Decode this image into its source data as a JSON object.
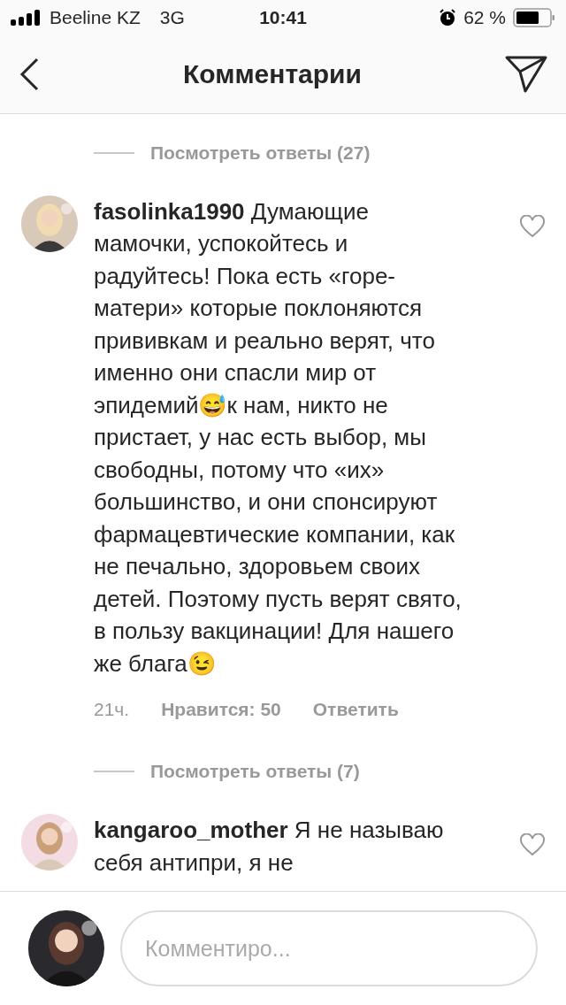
{
  "status_bar": {
    "carrier": "Beeline KZ",
    "network": "3G",
    "time": "10:41",
    "battery_percent": "62 %"
  },
  "header": {
    "title": "Комментарии"
  },
  "items": [
    {
      "kind": "replies",
      "label": "Посмотреть ответы (27)"
    },
    {
      "kind": "comment",
      "text": "**fasolinka1990** Думающие мамочки, успокойтесь и радуйтесь! Пока есть «горе-матери» которые поклоняются прививкам и реально верят, что именно они спасли мир от эпидемий😅к нам, никто не пристает, у нас есть выбор, мы свободны, потому что «их» большинство, и они спонсируют фармацевтические компании, как не печально, здоровьем своих детей. Поэтому пусть верят свято, в пользу вакцинации! Для нашего же блага😉",
      "time": "21ч.",
      "likes": "Нравится: 50",
      "reply": "Ответить"
    },
    {
      "kind": "replies",
      "label": "Посмотреть ответы (7)"
    },
    {
      "kind": "comment",
      "text": "**kangaroo_mother** Я не называю себя антипри, я не"
    }
  ],
  "composer": {
    "placeholder": "Комментиро..."
  }
}
